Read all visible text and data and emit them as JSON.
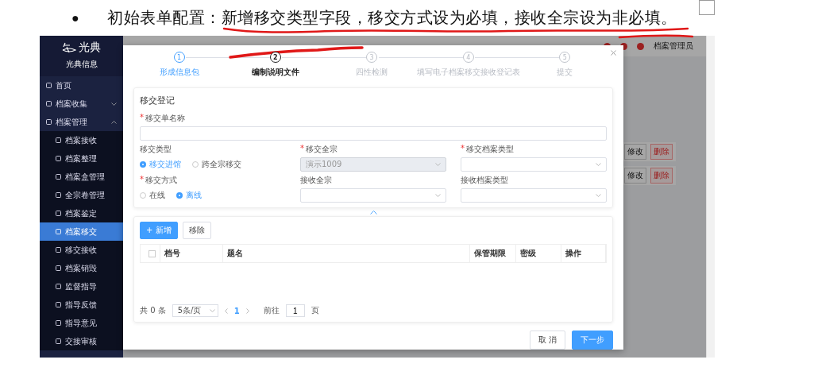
{
  "document": {
    "bullet": "●",
    "text": "初始表单配置：新增移交类型字段，移交方式设为必填，接收全宗设为非必填。"
  },
  "sidebar": {
    "logo": "光典",
    "company": "光典信息",
    "items": [
      {
        "label": "首页",
        "selected": false
      },
      {
        "label": "档案收集",
        "selected": false,
        "expanded": false
      },
      {
        "label": "档案管理",
        "selected": false,
        "expanded": true,
        "children": [
          {
            "label": "档案接收",
            "selected": false
          },
          {
            "label": "档案整理",
            "selected": false
          },
          {
            "label": "档案盒管理",
            "selected": false
          },
          {
            "label": "全宗卷管理",
            "selected": false
          },
          {
            "label": "档案鉴定",
            "selected": false
          },
          {
            "label": "档案移交",
            "selected": true
          },
          {
            "label": "移交接收",
            "selected": false
          },
          {
            "label": "档案销毁",
            "selected": false
          },
          {
            "label": "监督指导",
            "selected": false
          },
          {
            "label": "指导反馈",
            "selected": false
          },
          {
            "label": "指导意见",
            "selected": false
          },
          {
            "label": "交接审核",
            "selected": false
          }
        ]
      }
    ]
  },
  "background": {
    "user": "档案管理员",
    "rows": [
      {
        "actions": [
          "修改",
          "删除"
        ]
      },
      {
        "actions": [
          "修改",
          "删除"
        ]
      }
    ]
  },
  "modal": {
    "steps": [
      {
        "number": "1",
        "label": "形成信息包",
        "finished": true,
        "selected": false
      },
      {
        "number": "2",
        "label": "编制说明文件",
        "finished": false,
        "selected": true
      },
      {
        "number": "3",
        "label": "四性检测",
        "finished": false,
        "selected": false
      },
      {
        "number": "4",
        "label": "填写电子档案移交接收登记表",
        "finished": false,
        "selected": false
      },
      {
        "number": "5",
        "label": "提交",
        "finished": false,
        "selected": false
      }
    ],
    "form": {
      "title": "移交登记",
      "fields": [
        {
          "kind": "text",
          "required_mark": "*",
          "label": "移交单名称"
        },
        {
          "kind": "radio",
          "label": "移交类型",
          "options": [
            {
              "label": "移交进馆",
              "selected": true
            },
            {
              "label": "跨全宗移交",
              "selected": false
            }
          ]
        },
        {
          "kind": "select",
          "required_mark": "*",
          "label": "移交全宗",
          "value": "演示1009",
          "disabled": true
        },
        {
          "kind": "select",
          "required_mark": "*",
          "label": "移交档案类型",
          "disabled": false
        },
        {
          "kind": "radio",
          "required_mark": "*",
          "label": "移交方式",
          "options": [
            {
              "label": "在线",
              "selected": false
            },
            {
              "label": "离线",
              "selected": true
            }
          ]
        },
        {
          "kind": "select",
          "label": "接收全宗",
          "disabled": false
        },
        {
          "kind": "select",
          "label": "接收档案类型",
          "disabled": false
        }
      ]
    },
    "table": {
      "buttons": [
        {
          "label": "+ 新增",
          "kind": "primary"
        },
        {
          "label": "移除",
          "kind": "default"
        }
      ],
      "select_all_checked": false,
      "columns": [
        "档号",
        "题名",
        "保管期限",
        "密级",
        "操作"
      ],
      "pagination": {
        "total": "共 0 条",
        "page_size": "5条/页",
        "pages": [
          {
            "label": "1",
            "selected": true
          }
        ],
        "goto_label": "前往",
        "goto_value": "1",
        "page_unit": "页"
      }
    },
    "footer": [
      {
        "label": "取 消",
        "kind": "default"
      },
      {
        "label": "下一步",
        "kind": "primary"
      }
    ]
  }
}
